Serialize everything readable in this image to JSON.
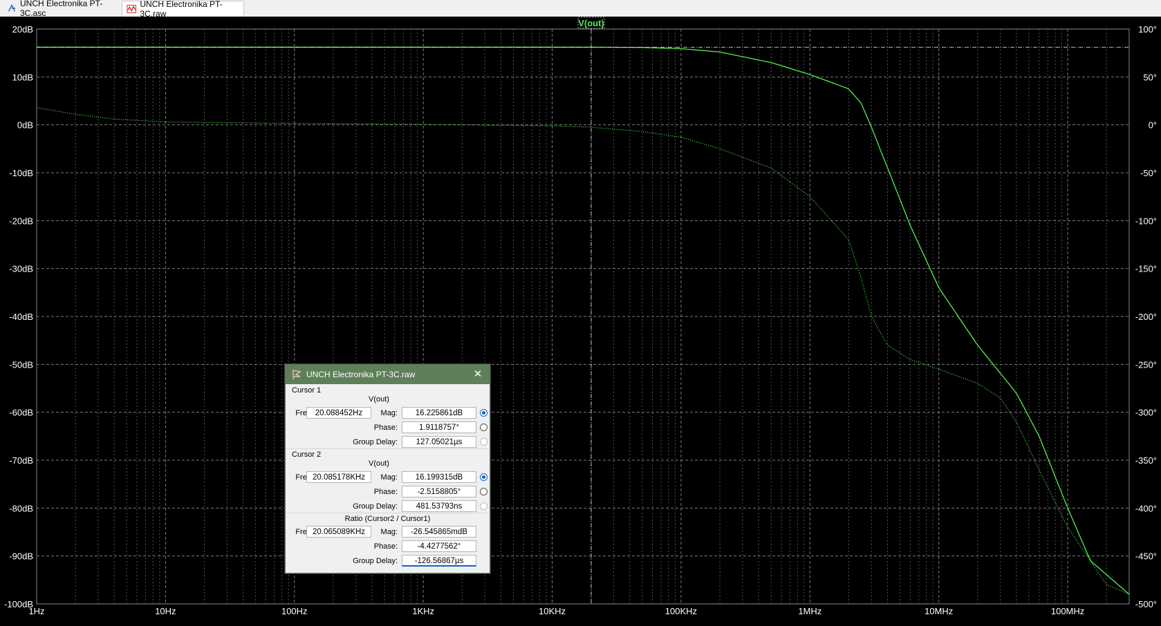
{
  "tabs": [
    {
      "label": "UNCH Electronika PT-3C.asc",
      "icon": "schematic-icon",
      "active": false
    },
    {
      "label": "UNCH Electronika PT-3C.raw",
      "icon": "waveform-icon",
      "active": true
    }
  ],
  "plot": {
    "trace_label": "V(out)",
    "trace_color": "#55ee55",
    "grid_color": "#8a8a8a",
    "left_ticks": [
      "20dB",
      "10dB",
      "0dB",
      "-10dB",
      "-20dB",
      "-30dB",
      "-40dB",
      "-50dB",
      "-60dB",
      "-70dB",
      "-80dB",
      "-90dB",
      "-100dB"
    ],
    "right_ticks": [
      "100°",
      "50°",
      "0°",
      "-50°",
      "-100°",
      "-150°",
      "-200°",
      "-250°",
      "-300°",
      "-350°",
      "-400°",
      "-450°",
      "-500°"
    ],
    "x_ticks": [
      "1Hz",
      "10Hz",
      "100Hz",
      "1KHz",
      "10KHz",
      "100KHz",
      "1MHz",
      "10MHz",
      "100MHz"
    ]
  },
  "chart_data": {
    "type": "line",
    "title": "V(out)",
    "x_scale": "log",
    "xlim": [
      1,
      300000000
    ],
    "y_left_range_db": [
      -100,
      20
    ],
    "y_right_range_deg": [
      -500,
      100
    ],
    "grid": true,
    "series": [
      {
        "name": "V(out)",
        "style": "solid",
        "axis": "magnitude",
        "points": [
          [
            1,
            16.2
          ],
          [
            10,
            16.2
          ],
          [
            100,
            16.2
          ],
          [
            1000,
            16.2
          ],
          [
            10000,
            16.2
          ],
          [
            20085,
            16.2
          ],
          [
            50000,
            16.15
          ],
          [
            100000,
            15.9
          ],
          [
            200000,
            15.2
          ],
          [
            500000,
            13
          ],
          [
            1000000,
            10.5
          ],
          [
            2000000,
            7.5
          ],
          [
            2500000,
            4.5
          ],
          [
            3000000,
            -0.5
          ],
          [
            4000000,
            -9
          ],
          [
            6000000,
            -21
          ],
          [
            10000000,
            -34
          ],
          [
            20000000,
            -46
          ],
          [
            40000000,
            -56
          ],
          [
            60000000,
            -65
          ],
          [
            100000000,
            -80
          ],
          [
            150000000,
            -91
          ],
          [
            300000000,
            -98
          ]
        ]
      },
      {
        "name": "V(out)",
        "style": "dotted",
        "axis": "phase",
        "points": [
          [
            1,
            18
          ],
          [
            2,
            11
          ],
          [
            4,
            6
          ],
          [
            10,
            3
          ],
          [
            100,
            1.5
          ],
          [
            1000,
            0.5
          ],
          [
            10000,
            -1
          ],
          [
            20085,
            -2.5
          ],
          [
            50000,
            -7
          ],
          [
            100000,
            -13
          ],
          [
            200000,
            -25
          ],
          [
            500000,
            -45
          ],
          [
            1000000,
            -75
          ],
          [
            2000000,
            -120
          ],
          [
            2500000,
            -160
          ],
          [
            3000000,
            -200
          ],
          [
            4000000,
            -230
          ],
          [
            6000000,
            -245
          ],
          [
            10000000,
            -255
          ],
          [
            20000000,
            -270
          ],
          [
            30000000,
            -285
          ],
          [
            40000000,
            -310
          ],
          [
            60000000,
            -360
          ],
          [
            100000000,
            -420
          ],
          [
            200000000,
            -480
          ],
          [
            300000000,
            -490
          ]
        ]
      }
    ]
  },
  "dialog": {
    "title": "UNCH Electronika PT-3C.raw",
    "cursor1": {
      "label": "Cursor 1",
      "trace": "V(out)",
      "freq_label": "Freq:",
      "freq": "20.088452Hz",
      "mag_label": "Mag:",
      "mag": "16.225861dB",
      "phase_label": "Phase:",
      "phase": "1.9118757°",
      "gd_label": "Group Delay:",
      "gd": "127.05021µs"
    },
    "cursor2": {
      "label": "Cursor 2",
      "trace": "V(out)",
      "freq_label": "Freq:",
      "freq": "20.085178KHz",
      "mag_label": "Mag:",
      "mag": "16.199315dB",
      "phase_label": "Phase:",
      "phase": "-2.5158805°",
      "gd_label": "Group Delay:",
      "gd": "481.53793ns"
    },
    "ratio": {
      "label": "Ratio (Cursor2 / Cursor1)",
      "freq_label": "Freq:",
      "freq": "20.065089KHz",
      "mag_label": "Mag:",
      "mag": "-26.545865mdB",
      "phase_label": "Phase:",
      "phase": "-4.4277562°",
      "gd_label": "Group Delay:",
      "gd": "-126.56867µs"
    }
  }
}
